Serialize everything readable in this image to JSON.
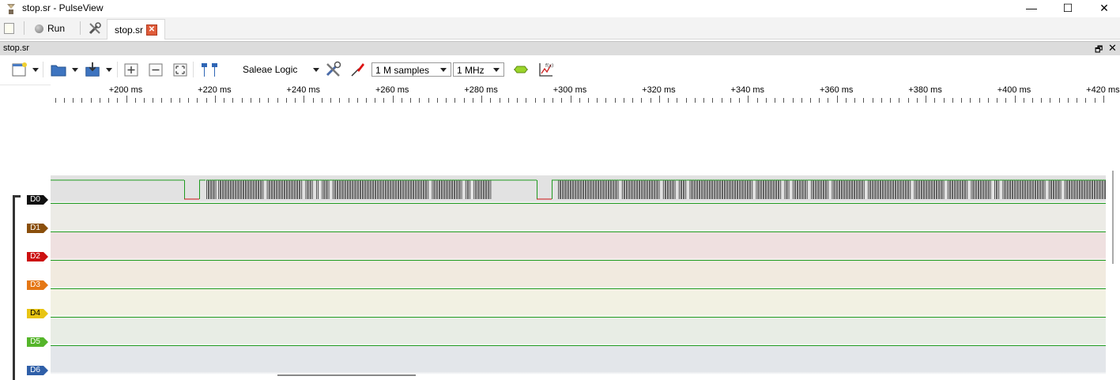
{
  "window": {
    "title": "stop.sr - PulseView",
    "minimize": "—",
    "maximize": "☐",
    "close": "✕"
  },
  "tabbar": {
    "run_label": "Run",
    "session_tab_label": "stop.sr",
    "session_close": "✕"
  },
  "dock": {
    "title": "stop.sr",
    "float": "🗗",
    "close": "✕"
  },
  "toolbar": {
    "device": "Saleae Logic",
    "sample_count": "1 M samples",
    "sample_rate": "1 MHz"
  },
  "ruler": {
    "labels": [
      "+200 ms",
      "+220 ms",
      "+240 ms",
      "+260 ms",
      "+280 ms",
      "+300 ms",
      "+320 ms",
      "+340 ms",
      "+360 ms",
      "+380 ms",
      "+400 ms",
      "+420 ms"
    ]
  },
  "channels": [
    {
      "name": "D0",
      "label_color": "#111111",
      "bg": "#e2e2e2"
    },
    {
      "name": "D1",
      "label_color": "#8a4f0c",
      "bg": "#ecebe6"
    },
    {
      "name": "D2",
      "label_color": "#cc1111",
      "bg": "#efe0e0"
    },
    {
      "name": "D3",
      "label_color": "#e57714",
      "bg": "#f1eadf"
    },
    {
      "name": "D4",
      "label_color": "#e8c413",
      "bg": "#f2f1e3"
    },
    {
      "name": "D5",
      "label_color": "#55b52a",
      "bg": "#e8ede5"
    },
    {
      "name": "D6",
      "label_color": "#2f5fa8",
      "bg": "#e3e6ea"
    }
  ],
  "colors": {
    "signal_high": "#1f9a1f",
    "signal_low": "#cc1111",
    "pulse": "#555555"
  }
}
